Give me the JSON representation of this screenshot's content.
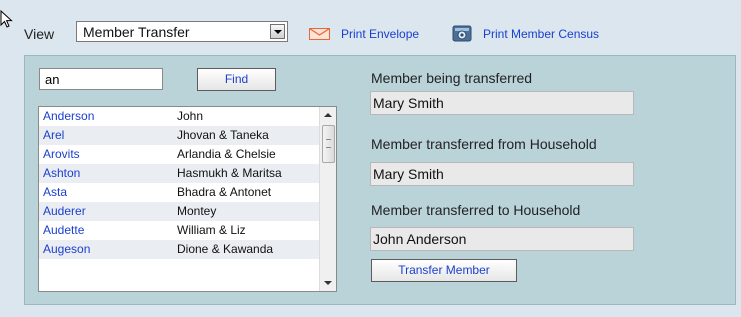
{
  "toolbar": {
    "view_label": "View",
    "view_selected": "Member Transfer",
    "print_envelope": "Print Envelope",
    "print_census": "Print Member Census"
  },
  "search": {
    "value": "an",
    "find_label": "Find"
  },
  "members": [
    {
      "last": "Anderson",
      "first": "John"
    },
    {
      "last": "Arel",
      "first": "Jhovan & Taneka"
    },
    {
      "last": "Arovits",
      "first": "Arlandia & Chelsie"
    },
    {
      "last": "Ashton",
      "first": "Hasmukh & Maritsa"
    },
    {
      "last": "Asta",
      "first": "Bhadra & Antonet"
    },
    {
      "last": "Auderer",
      "first": "Montey"
    },
    {
      "last": "Audette",
      "first": "William & Liz"
    },
    {
      "last": "Augeson",
      "first": "Dione & Kawanda"
    }
  ],
  "transfer": {
    "member_label": "Member being transferred",
    "member_value": "Mary Smith",
    "from_label": "Member transferred from Household",
    "from_value": "Mary Smith",
    "to_label": "Member transferred to Household",
    "to_value": "John Anderson",
    "button_label": "Transfer Member"
  },
  "colors": {
    "link": "#1a3fcf",
    "panel": "#b9d3d9",
    "page": "#dbe6ee"
  },
  "icons": {
    "envelope": "envelope-icon",
    "census": "census-icon",
    "cursor": "mouse-cursor-icon"
  }
}
